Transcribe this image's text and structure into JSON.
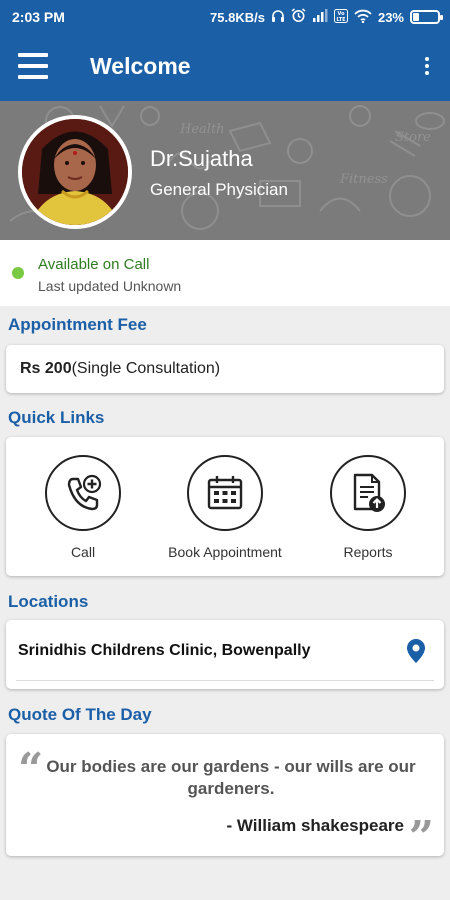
{
  "status_bar": {
    "time": "2:03 PM",
    "network_speed": "75.8KB/s",
    "battery_percent": "23%",
    "battery_level": 0.23,
    "icons": [
      "headphones-icon",
      "alarm-icon",
      "signal-icon",
      "volte-icon",
      "wifi-icon",
      "battery-icon"
    ]
  },
  "app_bar": {
    "title": "Welcome",
    "menu_icon": "hamburger-menu-icon",
    "overflow_icon": "more-vert-icon"
  },
  "profile": {
    "name": "Dr.Sujatha",
    "specialization": "General Physician"
  },
  "availability": {
    "status": "Available on Call",
    "last_updated": "Last updated Unknown",
    "status_color": "#7ac943"
  },
  "appointment_fee": {
    "title": "Appointment Fee",
    "amount": "Rs 200",
    "description": "(Single Consultation)"
  },
  "quick_links": {
    "title": "Quick Links",
    "items": [
      {
        "label": "Call",
        "icon": "phone-plus-icon"
      },
      {
        "label": "Book Appointment",
        "icon": "calendar-icon"
      },
      {
        "label": "Reports",
        "icon": "report-upload-icon"
      }
    ]
  },
  "locations": {
    "title": "Locations",
    "items": [
      {
        "name": "Srinidhis Childrens Clinic, Bowenpally",
        "icon": "location-pin-icon"
      }
    ]
  },
  "quote": {
    "title": "Quote Of The Day",
    "text": "Our bodies are our gardens - our wills are our gardeners.",
    "author": "- William shakespeare"
  },
  "colors": {
    "primary": "#1b5fa7",
    "background": "#eeeeee",
    "available": "#7ac943",
    "available_text": "#2e7d1f"
  }
}
